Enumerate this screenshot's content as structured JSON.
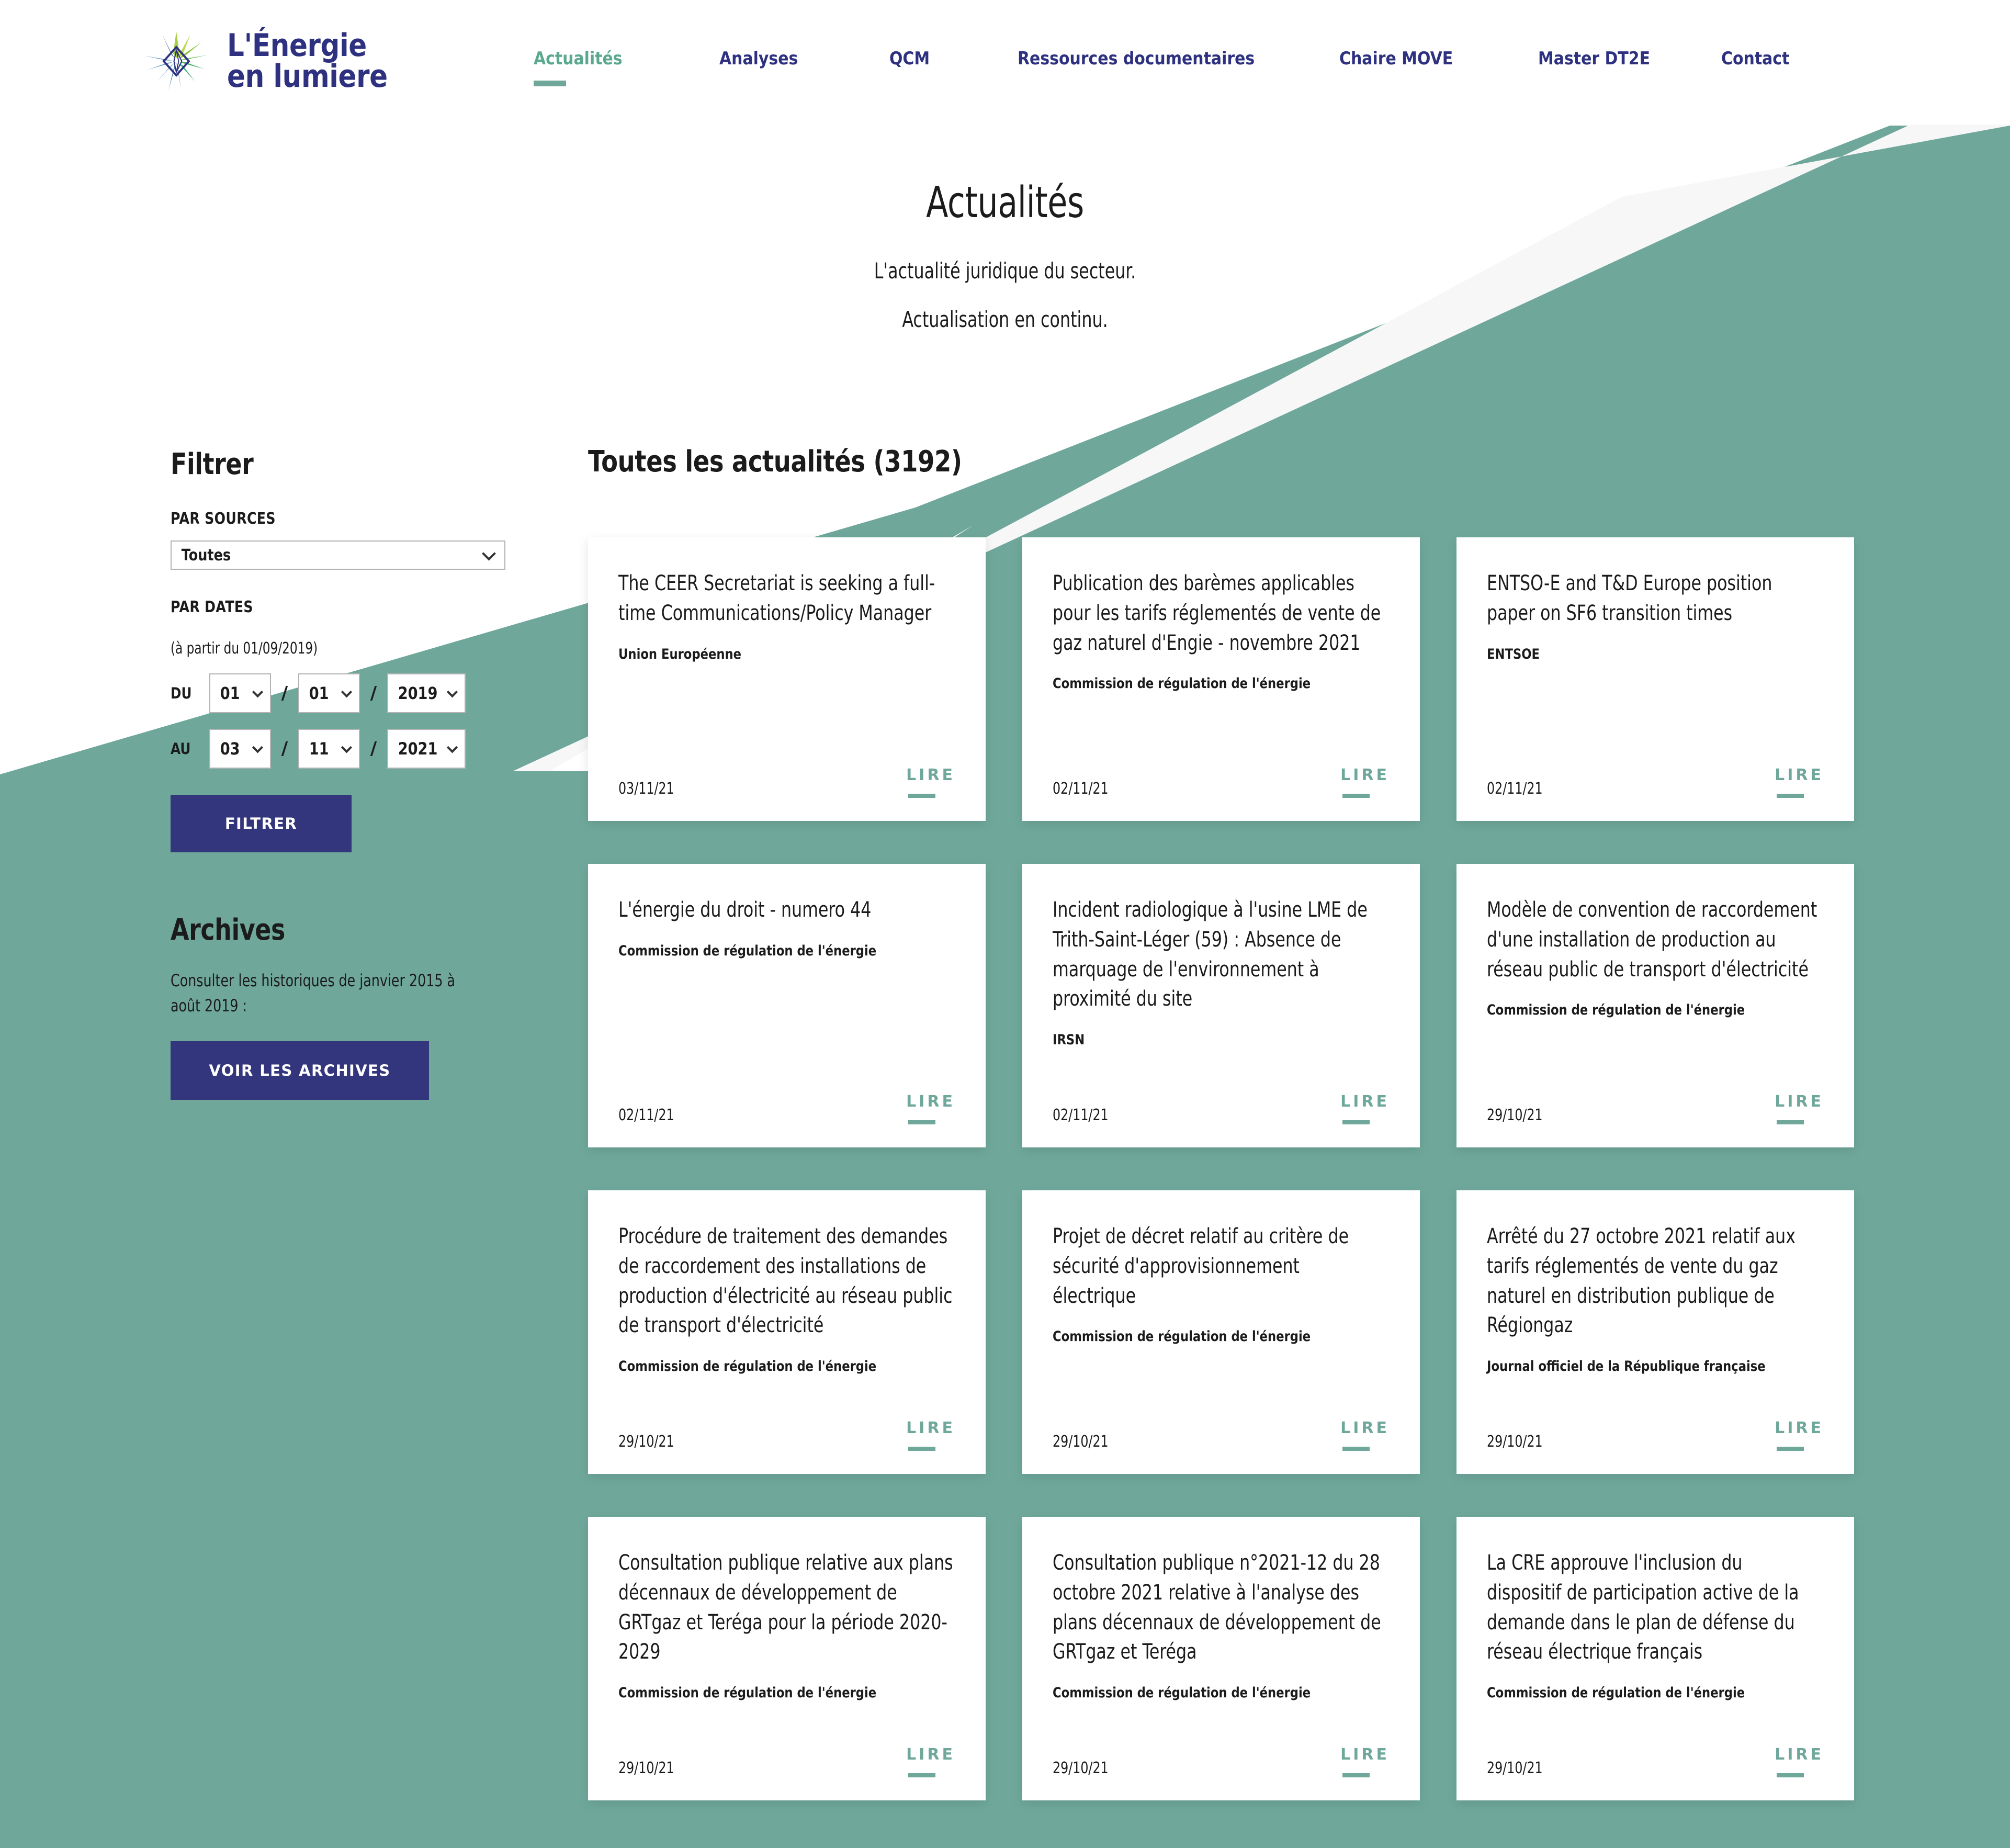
{
  "brand": {
    "logo_icon": "starburst-diamond-logo",
    "line1": "L'Énergie",
    "line2": "en lumiere",
    "navy": "#2e3180",
    "green": "#6fa89b"
  },
  "nav": {
    "items": [
      {
        "label": "Actualités",
        "active": true
      },
      {
        "label": "Analyses",
        "active": false
      },
      {
        "label": "QCM",
        "active": false
      },
      {
        "label": "Ressources documentaires",
        "active": false
      },
      {
        "label": "Chaire MOVE",
        "active": false
      },
      {
        "label": "Master DT2E",
        "active": false
      },
      {
        "label": "Contact",
        "active": false
      }
    ]
  },
  "hero": {
    "title": "Actualités",
    "subtitle1": "L'actualité juridique du secteur.",
    "subtitle2": "Actualisation en continu."
  },
  "sidebar": {
    "filter_heading": "Filtrer",
    "sources_label": "PAR SOURCES",
    "source_selected": "Toutes",
    "dates_label": "PAR DATES",
    "dates_note": "(à partir du 01/09/2019)",
    "from_label": "DU",
    "to_label": "AU",
    "separator": "/",
    "from": {
      "day": "01",
      "month": "01",
      "year": "2019"
    },
    "to": {
      "day": "03",
      "month": "11",
      "year": "2021"
    },
    "filter_button": "FILTRER",
    "archives_heading": "Archives",
    "archives_text": "Consulter les historiques de janvier 2015 à août 2019 :",
    "archives_button": "VOIR LES ARCHIVES"
  },
  "content": {
    "heading": "Toutes les actualités (3192)",
    "read_label": "LIRE",
    "cards": [
      {
        "title": "The CEER Secretariat is seeking a full-time Communications/Policy Manager",
        "source": "Union Européenne",
        "date": "03/11/21"
      },
      {
        "title": "Publication des barèmes applicables pour les tarifs réglementés de vente de gaz naturel d'Engie - novembre 2021",
        "source": "Commission de régulation de l'énergie",
        "date": "02/11/21"
      },
      {
        "title": "ENTSO-E and T&D Europe position paper on SF6 transition times",
        "source": "ENTSOE",
        "date": "02/11/21"
      },
      {
        "title": "L'énergie du droit - numero 44",
        "source": "Commission de régulation de l'énergie",
        "date": "02/11/21"
      },
      {
        "title": "Incident radiologique à l'usine LME de Trith-Saint-Léger (59) : Absence de marquage de l'environnement à proximité du site",
        "source": "IRSN",
        "date": "02/11/21"
      },
      {
        "title": "Modèle de convention de raccordement d'une installation de production au réseau public de transport d'électricité",
        "source": "Commission de régulation de l'énergie",
        "date": "29/10/21"
      },
      {
        "title": "Procédure de traitement des demandes de raccordement des installations de production d'électricité au réseau public de transport d'électricité",
        "source": "Commission de régulation de l'énergie",
        "date": "29/10/21"
      },
      {
        "title": "Projet de décret relatif au critère de sécurité d'approvisionnement électrique",
        "source": "Commission de régulation de l'énergie",
        "date": "29/10/21"
      },
      {
        "title": "Arrêté du 27 octobre 2021 relatif aux tarifs réglementés de vente du gaz naturel en distribution publique de Régiongaz",
        "source": "Journal officiel de la République française",
        "date": "29/10/21"
      },
      {
        "title": "Consultation publique relative aux plans décennaux de développement de GRTgaz et Teréga pour la période 2020-2029",
        "source": "Commission de régulation de l'énergie",
        "date": "29/10/21"
      },
      {
        "title": "Consultation publique n°2021-12 du 28 octobre 2021 relative à l'analyse des plans décennaux de développement de GRTgaz et Teréga",
        "source": "Commission de régulation de l'énergie",
        "date": "29/10/21"
      },
      {
        "title": "La CRE approuve l'inclusion du dispositif de participation active de la demande dans le plan de défense du réseau électrique français",
        "source": "Commission de régulation de l'énergie",
        "date": "29/10/21"
      }
    ]
  }
}
